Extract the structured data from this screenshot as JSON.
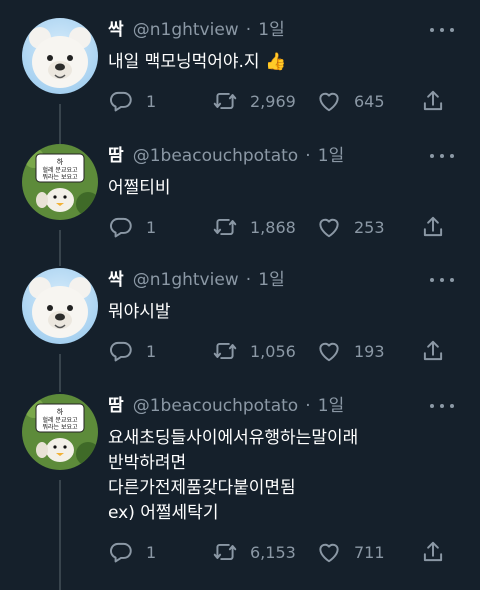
{
  "tweets": [
    {
      "name": "싹",
      "handle": "@n1ghtview",
      "separator": "·",
      "time": "1일",
      "text": "내일 맥모닝먹어야.지",
      "emoji": "👍",
      "replies": "1",
      "retweets": "2,969",
      "likes": "645"
    },
    {
      "name": "땀",
      "handle": "@1beacouchpotato",
      "separator": "·",
      "time": "1일",
      "text": "어쩔티비",
      "replies": "1",
      "retweets": "1,868",
      "likes": "253"
    },
    {
      "name": "싹",
      "handle": "@n1ghtview",
      "separator": "·",
      "time": "1일",
      "text": "뭐야시발",
      "replies": "1",
      "retweets": "1,056",
      "likes": "193"
    },
    {
      "name": "땀",
      "handle": "@1beacouchpotato",
      "separator": "·",
      "time": "1일",
      "text": "요새초딩들사이에서유행하는말이래\n반박하려면\n다른가전제품갖다붙이면됨\nex) 어쩔세탁기",
      "replies": "1",
      "retweets": "6,153",
      "likes": "711"
    }
  ],
  "avatar_sticker_text": "하 헐레 분교요고\n뭐라는 보요고",
  "colors": {
    "background": "#15202b",
    "secondary_text": "#8b98a5",
    "thread_line": "#38444d"
  }
}
